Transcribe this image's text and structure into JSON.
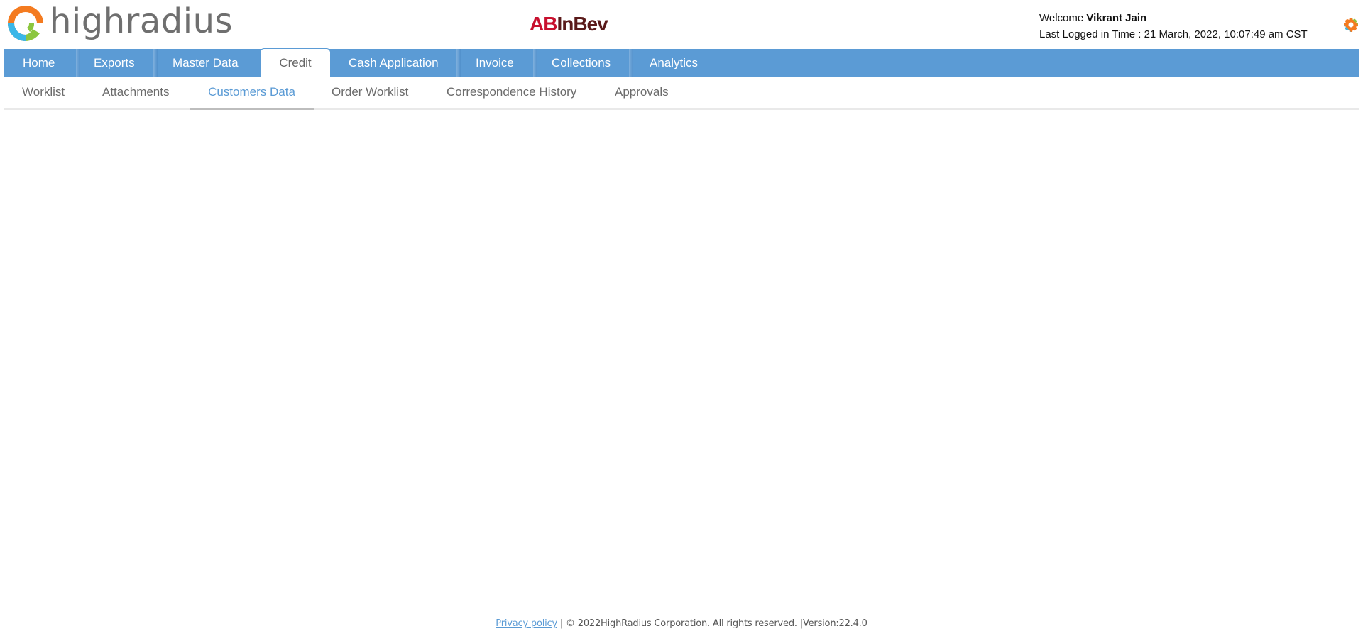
{
  "header": {
    "logo_text": "highradius",
    "brand_ab": "AB",
    "brand_inbev": "InBev",
    "welcome_prefix": "Welcome",
    "user_name": "Vikrant Jain",
    "last_logged_in": "Last Logged in Time : 21 March, 2022, 10:07:49 am CST",
    "settings_icon": "gear-icon"
  },
  "main_nav": {
    "tabs": [
      {
        "label": "Home"
      },
      {
        "label": "Exports"
      },
      {
        "label": "Master Data"
      },
      {
        "label": "Credit",
        "active": true
      },
      {
        "label": "Cash Application"
      },
      {
        "label": "Invoice"
      },
      {
        "label": "Collections"
      },
      {
        "label": "Analytics"
      }
    ]
  },
  "sub_nav": {
    "tabs": [
      {
        "label": "Worklist"
      },
      {
        "label": "Attachments"
      },
      {
        "label": "Customers Data",
        "active": true
      },
      {
        "label": "Order Worklist"
      },
      {
        "label": "Correspondence History"
      },
      {
        "label": "Approvals"
      }
    ]
  },
  "footer": {
    "privacy_link": "Privacy policy",
    "text": " | © 2022HighRadius Corporation. All rights reserved. |Version:22.4.0"
  },
  "colors": {
    "nav_blue": "#5b9bd5",
    "active_sub_text": "#5b9bd5",
    "brand_red": "#c8102e",
    "logo_orange": "#f47b20",
    "logo_blue": "#3ab7e8",
    "logo_green": "#8cc63f"
  }
}
